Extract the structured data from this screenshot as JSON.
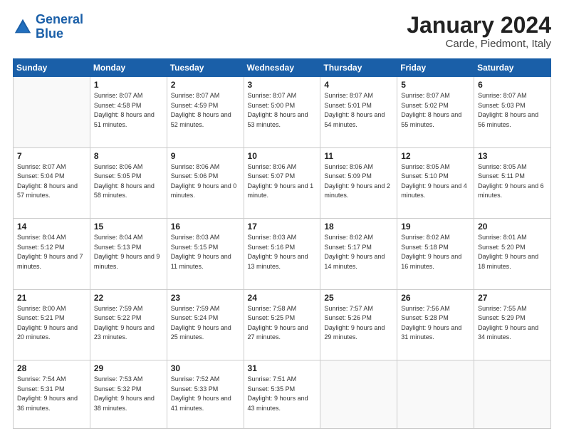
{
  "logo": {
    "line1": "General",
    "line2": "Blue"
  },
  "header": {
    "month": "January 2024",
    "location": "Carde, Piedmont, Italy"
  },
  "weekdays": [
    "Sunday",
    "Monday",
    "Tuesday",
    "Wednesday",
    "Thursday",
    "Friday",
    "Saturday"
  ],
  "weeks": [
    [
      {
        "day": "",
        "sunrise": "",
        "sunset": "",
        "daylight": ""
      },
      {
        "day": "1",
        "sunrise": "Sunrise: 8:07 AM",
        "sunset": "Sunset: 4:58 PM",
        "daylight": "Daylight: 8 hours and 51 minutes."
      },
      {
        "day": "2",
        "sunrise": "Sunrise: 8:07 AM",
        "sunset": "Sunset: 4:59 PM",
        "daylight": "Daylight: 8 hours and 52 minutes."
      },
      {
        "day": "3",
        "sunrise": "Sunrise: 8:07 AM",
        "sunset": "Sunset: 5:00 PM",
        "daylight": "Daylight: 8 hours and 53 minutes."
      },
      {
        "day": "4",
        "sunrise": "Sunrise: 8:07 AM",
        "sunset": "Sunset: 5:01 PM",
        "daylight": "Daylight: 8 hours and 54 minutes."
      },
      {
        "day": "5",
        "sunrise": "Sunrise: 8:07 AM",
        "sunset": "Sunset: 5:02 PM",
        "daylight": "Daylight: 8 hours and 55 minutes."
      },
      {
        "day": "6",
        "sunrise": "Sunrise: 8:07 AM",
        "sunset": "Sunset: 5:03 PM",
        "daylight": "Daylight: 8 hours and 56 minutes."
      }
    ],
    [
      {
        "day": "7",
        "sunrise": "Sunrise: 8:07 AM",
        "sunset": "Sunset: 5:04 PM",
        "daylight": "Daylight: 8 hours and 57 minutes."
      },
      {
        "day": "8",
        "sunrise": "Sunrise: 8:06 AM",
        "sunset": "Sunset: 5:05 PM",
        "daylight": "Daylight: 8 hours and 58 minutes."
      },
      {
        "day": "9",
        "sunrise": "Sunrise: 8:06 AM",
        "sunset": "Sunset: 5:06 PM",
        "daylight": "Daylight: 9 hours and 0 minutes."
      },
      {
        "day": "10",
        "sunrise": "Sunrise: 8:06 AM",
        "sunset": "Sunset: 5:07 PM",
        "daylight": "Daylight: 9 hours and 1 minute."
      },
      {
        "day": "11",
        "sunrise": "Sunrise: 8:06 AM",
        "sunset": "Sunset: 5:09 PM",
        "daylight": "Daylight: 9 hours and 2 minutes."
      },
      {
        "day": "12",
        "sunrise": "Sunrise: 8:05 AM",
        "sunset": "Sunset: 5:10 PM",
        "daylight": "Daylight: 9 hours and 4 minutes."
      },
      {
        "day": "13",
        "sunrise": "Sunrise: 8:05 AM",
        "sunset": "Sunset: 5:11 PM",
        "daylight": "Daylight: 9 hours and 6 minutes."
      }
    ],
    [
      {
        "day": "14",
        "sunrise": "Sunrise: 8:04 AM",
        "sunset": "Sunset: 5:12 PM",
        "daylight": "Daylight: 9 hours and 7 minutes."
      },
      {
        "day": "15",
        "sunrise": "Sunrise: 8:04 AM",
        "sunset": "Sunset: 5:13 PM",
        "daylight": "Daylight: 9 hours and 9 minutes."
      },
      {
        "day": "16",
        "sunrise": "Sunrise: 8:03 AM",
        "sunset": "Sunset: 5:15 PM",
        "daylight": "Daylight: 9 hours and 11 minutes."
      },
      {
        "day": "17",
        "sunrise": "Sunrise: 8:03 AM",
        "sunset": "Sunset: 5:16 PM",
        "daylight": "Daylight: 9 hours and 13 minutes."
      },
      {
        "day": "18",
        "sunrise": "Sunrise: 8:02 AM",
        "sunset": "Sunset: 5:17 PM",
        "daylight": "Daylight: 9 hours and 14 minutes."
      },
      {
        "day": "19",
        "sunrise": "Sunrise: 8:02 AM",
        "sunset": "Sunset: 5:18 PM",
        "daylight": "Daylight: 9 hours and 16 minutes."
      },
      {
        "day": "20",
        "sunrise": "Sunrise: 8:01 AM",
        "sunset": "Sunset: 5:20 PM",
        "daylight": "Daylight: 9 hours and 18 minutes."
      }
    ],
    [
      {
        "day": "21",
        "sunrise": "Sunrise: 8:00 AM",
        "sunset": "Sunset: 5:21 PM",
        "daylight": "Daylight: 9 hours and 20 minutes."
      },
      {
        "day": "22",
        "sunrise": "Sunrise: 7:59 AM",
        "sunset": "Sunset: 5:22 PM",
        "daylight": "Daylight: 9 hours and 23 minutes."
      },
      {
        "day": "23",
        "sunrise": "Sunrise: 7:59 AM",
        "sunset": "Sunset: 5:24 PM",
        "daylight": "Daylight: 9 hours and 25 minutes."
      },
      {
        "day": "24",
        "sunrise": "Sunrise: 7:58 AM",
        "sunset": "Sunset: 5:25 PM",
        "daylight": "Daylight: 9 hours and 27 minutes."
      },
      {
        "day": "25",
        "sunrise": "Sunrise: 7:57 AM",
        "sunset": "Sunset: 5:26 PM",
        "daylight": "Daylight: 9 hours and 29 minutes."
      },
      {
        "day": "26",
        "sunrise": "Sunrise: 7:56 AM",
        "sunset": "Sunset: 5:28 PM",
        "daylight": "Daylight: 9 hours and 31 minutes."
      },
      {
        "day": "27",
        "sunrise": "Sunrise: 7:55 AM",
        "sunset": "Sunset: 5:29 PM",
        "daylight": "Daylight: 9 hours and 34 minutes."
      }
    ],
    [
      {
        "day": "28",
        "sunrise": "Sunrise: 7:54 AM",
        "sunset": "Sunset: 5:31 PM",
        "daylight": "Daylight: 9 hours and 36 minutes."
      },
      {
        "day": "29",
        "sunrise": "Sunrise: 7:53 AM",
        "sunset": "Sunset: 5:32 PM",
        "daylight": "Daylight: 9 hours and 38 minutes."
      },
      {
        "day": "30",
        "sunrise": "Sunrise: 7:52 AM",
        "sunset": "Sunset: 5:33 PM",
        "daylight": "Daylight: 9 hours and 41 minutes."
      },
      {
        "day": "31",
        "sunrise": "Sunrise: 7:51 AM",
        "sunset": "Sunset: 5:35 PM",
        "daylight": "Daylight: 9 hours and 43 minutes."
      },
      {
        "day": "",
        "sunrise": "",
        "sunset": "",
        "daylight": ""
      },
      {
        "day": "",
        "sunrise": "",
        "sunset": "",
        "daylight": ""
      },
      {
        "day": "",
        "sunrise": "",
        "sunset": "",
        "daylight": ""
      }
    ]
  ]
}
